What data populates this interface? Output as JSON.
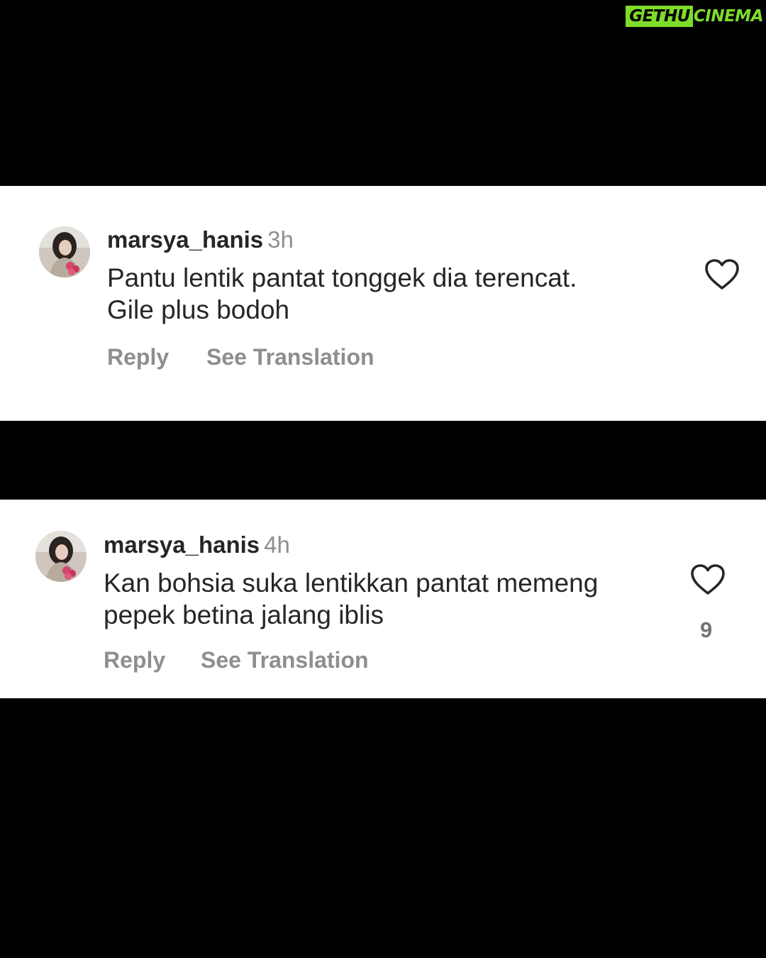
{
  "watermark": {
    "left": "GETHU",
    "right": "CINEMA"
  },
  "comments": [
    {
      "username": "marsya_hanis",
      "time": "3h",
      "text_lines": [
        "Pantu lentik pantat tonggek dia terencat.",
        "Gile plus bodoh"
      ],
      "reply_label": "Reply",
      "translate_label": "See Translation",
      "like_count": ""
    },
    {
      "username": "marsya_hanis",
      "time": "4h",
      "text_lines": [
        "Kan bohsia suka lentikkan pantat memeng",
        "pepek betina jalang iblis"
      ],
      "reply_label": "Reply",
      "translate_label": "See Translation",
      "like_count": "9"
    }
  ],
  "icons": {
    "like": "heart-outline-icon"
  },
  "colors": {
    "background": "#000000",
    "panel": "#ffffff",
    "text": "#262626",
    "muted": "#8e8e8e",
    "watermark": "#7fdc2a"
  }
}
